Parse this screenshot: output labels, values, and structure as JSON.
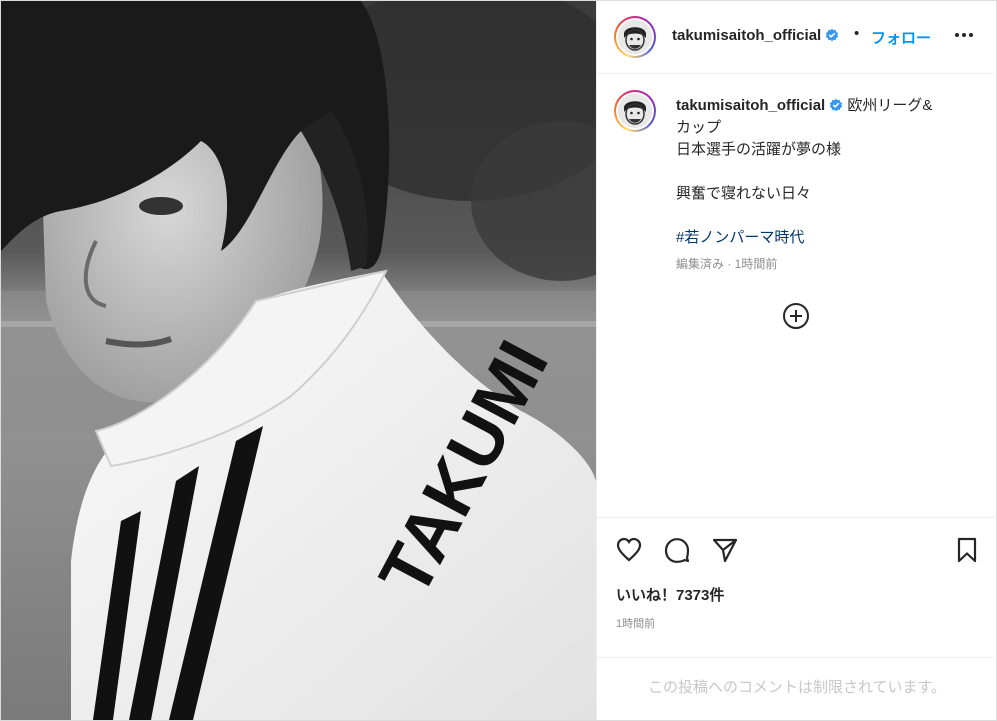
{
  "header": {
    "username": "takumisaitoh_official",
    "separator": "•",
    "follow_label": "フォロー",
    "avatar_icon": "profile-avatar",
    "verified_icon": "verified-badge-icon",
    "more_icon": "more-options-icon"
  },
  "caption": {
    "username": "takumisaitoh_official",
    "lines": [
      "欧州リーグ&",
      "カップ",
      "日本選手の活躍が夢の様",
      "",
      "興奮で寝れない日々",
      ""
    ],
    "hashtag": "#若ノンパーマ時代",
    "meta": "編集済み · 1時間前",
    "add_icon": "add-circle-icon"
  },
  "photo": {
    "jacket_lettering": "TAKUMI",
    "description_icon": "post-photo"
  },
  "actions": {
    "like_icon": "heart-icon",
    "comment_icon": "comment-icon",
    "share_icon": "share-icon",
    "save_icon": "bookmark-icon",
    "likes": "いいね！7373件",
    "time_ago": "1時間前"
  },
  "comment_bar": {
    "text": "この投稿へのコメントは制限されています。"
  },
  "colors": {
    "accent": "#0095f6",
    "hashtag": "#00376b",
    "muted": "#8e8e8e",
    "verified": "#3897f0"
  }
}
